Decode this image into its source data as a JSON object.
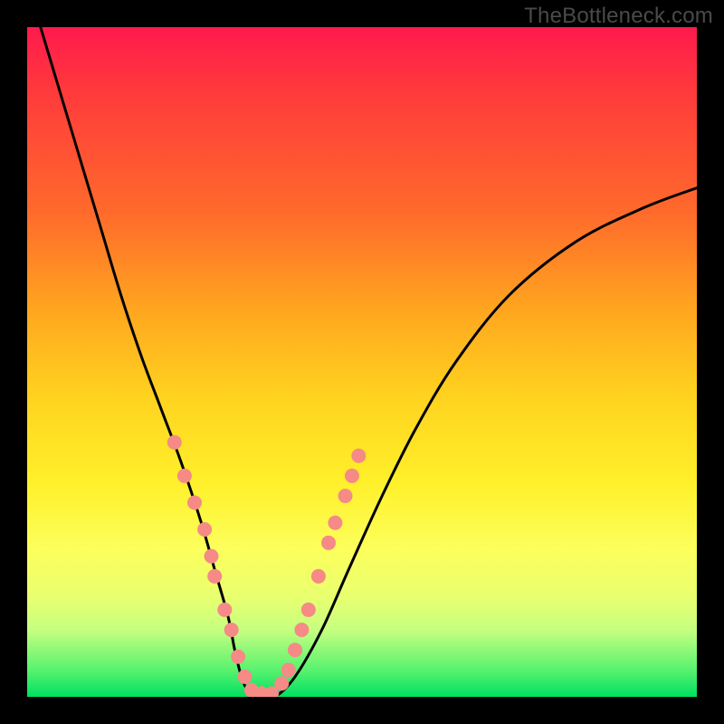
{
  "watermark": "TheBottleneck.com",
  "chart_data": {
    "type": "line",
    "title": "",
    "xlabel": "",
    "ylabel": "",
    "xlim": [
      0,
      100
    ],
    "ylim": [
      0,
      100
    ],
    "series": [
      {
        "name": "bottleneck-curve",
        "x": [
          2,
          5,
          8,
          11,
          14,
          17,
          20,
          23,
          26,
          28,
          30,
          31,
          32,
          33,
          35,
          37,
          40,
          44,
          48,
          53,
          58,
          64,
          72,
          82,
          92,
          100
        ],
        "y": [
          100,
          90,
          80,
          70,
          60,
          51,
          43,
          35,
          26,
          19,
          12,
          7,
          3,
          1,
          0,
          0,
          3,
          10,
          19,
          30,
          40,
          50,
          60,
          68,
          73,
          76
        ]
      }
    ],
    "markers": {
      "name": "highlight-dots",
      "color": "#f58a86",
      "radius_px": 8,
      "points": [
        {
          "x": 22,
          "y": 38
        },
        {
          "x": 23.5,
          "y": 33
        },
        {
          "x": 25,
          "y": 29
        },
        {
          "x": 26.5,
          "y": 25
        },
        {
          "x": 27.5,
          "y": 21
        },
        {
          "x": 28,
          "y": 18
        },
        {
          "x": 29.5,
          "y": 13
        },
        {
          "x": 30.5,
          "y": 10
        },
        {
          "x": 31.5,
          "y": 6
        },
        {
          "x": 32.5,
          "y": 3
        },
        {
          "x": 33.5,
          "y": 1
        },
        {
          "x": 35,
          "y": 0.5
        },
        {
          "x": 36.5,
          "y": 0.5
        },
        {
          "x": 38,
          "y": 2
        },
        {
          "x": 39,
          "y": 4
        },
        {
          "x": 40,
          "y": 7
        },
        {
          "x": 41,
          "y": 10
        },
        {
          "x": 42,
          "y": 13
        },
        {
          "x": 43.5,
          "y": 18
        },
        {
          "x": 45,
          "y": 23
        },
        {
          "x": 46,
          "y": 26
        },
        {
          "x": 47.5,
          "y": 30
        },
        {
          "x": 48.5,
          "y": 33
        },
        {
          "x": 49.5,
          "y": 36
        }
      ]
    }
  }
}
